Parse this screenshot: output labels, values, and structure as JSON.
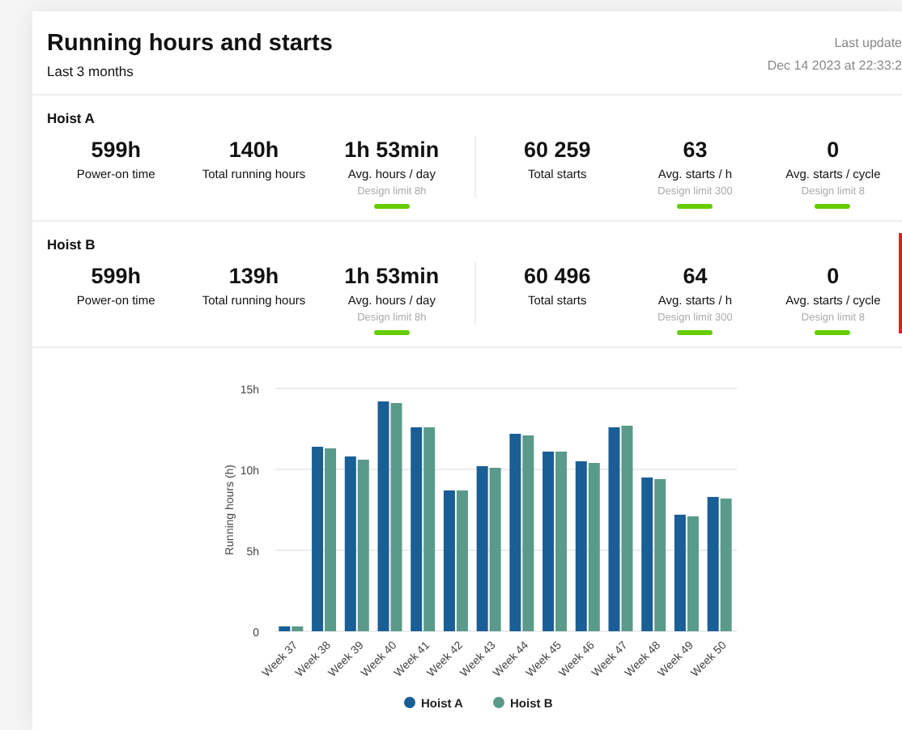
{
  "header": {
    "title": "Running hours and starts",
    "subtitle": "Last 3 months",
    "updated_label": "Last update",
    "updated_time": "Dec 14 2023 at 22:33:2"
  },
  "hoists": [
    {
      "name": "Hoist A",
      "alert": false,
      "metrics": [
        {
          "value": "599h",
          "label": "Power-on time"
        },
        {
          "value": "140h",
          "label": "Total running hours"
        },
        {
          "value": "1h 53min",
          "label": "Avg. hours / day",
          "limit": "Design limit 8h"
        },
        {
          "value": "60 259",
          "label": "Total starts"
        },
        {
          "value": "63",
          "label": "Avg. starts / h",
          "limit": "Design limit 300"
        },
        {
          "value": "0",
          "label": "Avg. starts / cycle",
          "limit": "Design limit 8"
        }
      ]
    },
    {
      "name": "Hoist B",
      "alert": true,
      "metrics": [
        {
          "value": "599h",
          "label": "Power-on time"
        },
        {
          "value": "139h",
          "label": "Total running hours"
        },
        {
          "value": "1h 53min",
          "label": "Avg. hours / day",
          "limit": "Design limit 8h"
        },
        {
          "value": "60 496",
          "label": "Total starts"
        },
        {
          "value": "64",
          "label": "Avg. starts / h",
          "limit": "Design limit 300"
        },
        {
          "value": "0",
          "label": "Avg. starts / cycle",
          "limit": "Design limit 8"
        }
      ]
    }
  ],
  "chart": {
    "chart_data": {
      "type": "bar",
      "ylabel": "Running hours (h)",
      "categories": [
        "Week 37",
        "Week 38",
        "Week 39",
        "Week 40",
        "Week 41",
        "Week 42",
        "Week 43",
        "Week 44",
        "Week 45",
        "Week 46",
        "Week 47",
        "Week 48",
        "Week 49",
        "Week 50"
      ],
      "series": [
        {
          "name": "Hoist A",
          "color": "#1a5e96",
          "values": [
            0.3,
            11.4,
            10.8,
            14.2,
            12.6,
            8.7,
            10.2,
            12.2,
            11.1,
            10.5,
            12.6,
            9.5,
            7.2,
            8.3
          ]
        },
        {
          "name": "Hoist B",
          "color": "#5a9a8a",
          "values": [
            0.3,
            11.3,
            10.6,
            14.1,
            12.6,
            8.7,
            10.1,
            12.1,
            11.1,
            10.4,
            12.7,
            9.4,
            7.1,
            8.2
          ]
        }
      ],
      "legend": "bottom",
      "ylim": [
        0,
        15
      ],
      "yticks": [
        {
          "value": 0,
          "label": "0"
        },
        {
          "value": 5,
          "label": "5h"
        },
        {
          "value": 10,
          "label": "10h"
        },
        {
          "value": 15,
          "label": "15h"
        }
      ]
    }
  }
}
